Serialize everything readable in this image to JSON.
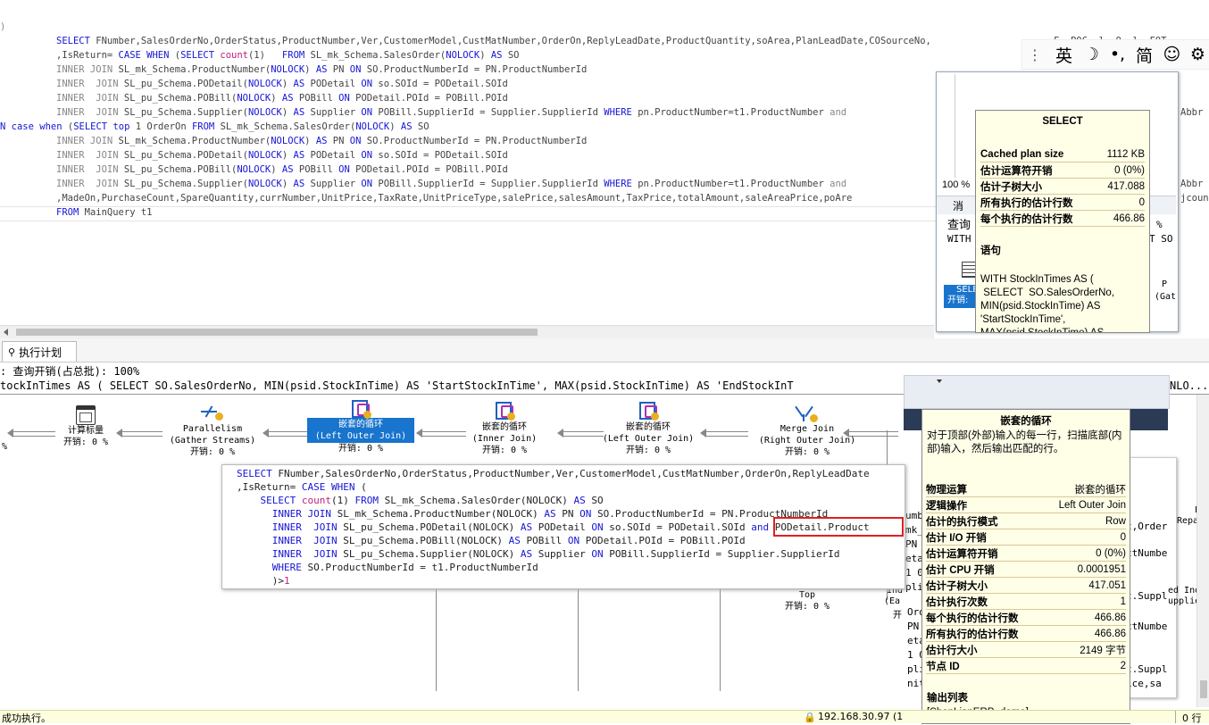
{
  "sql_editor": {
    "lines": [
      {
        "indent": 0,
        "parts": [
          {
            "t": ")",
            "c": "gray"
          }
        ]
      },
      {
        "indent": 63,
        "parts": [
          {
            "t": "SELECT",
            "c": "kw"
          },
          {
            "t": " FNumber,SalesOrderNo,OrderStatus,ProductNumber,Ver,CustomerModel,CustMatNumber,OrderOn,ReplyLeadDate,ProductQuantity,soArea,PlanLeadDate,COSourceNo,",
            "c": ""
          }
        ]
      },
      {
        "indent": 63,
        "parts": [
          {
            "t": ",IsReturn= ",
            "c": ""
          },
          {
            "t": "CASE WHEN",
            "c": "kw"
          },
          {
            "t": " (",
            "c": ""
          },
          {
            "t": "SELECT",
            "c": "kw"
          },
          {
            "t": " ",
            "c": ""
          },
          {
            "t": "count",
            "c": "fn"
          },
          {
            "t": "(1)   ",
            "c": ""
          },
          {
            "t": "FROM",
            "c": "kw"
          },
          {
            "t": " SL_mk_Schema.SalesOrder(",
            "c": ""
          },
          {
            "t": "NOLOCK",
            "c": "kw"
          },
          {
            "t": ") ",
            "c": ""
          },
          {
            "t": "AS",
            "c": "kw"
          },
          {
            "t": " SO",
            "c": ""
          }
        ]
      },
      {
        "indent": 63,
        "parts": [
          {
            "t": "INNER JOIN",
            "c": "gray"
          },
          {
            "t": " SL_mk_Schema.ProductNumber(",
            "c": ""
          },
          {
            "t": "NOLOCK",
            "c": "kw"
          },
          {
            "t": ") ",
            "c": ""
          },
          {
            "t": "AS",
            "c": "kw"
          },
          {
            "t": " PN ",
            "c": ""
          },
          {
            "t": "ON",
            "c": "kw"
          },
          {
            "t": " SO.ProductNumberId = PN.ProductNumberId",
            "c": ""
          }
        ]
      },
      {
        "indent": 63,
        "parts": [
          {
            "t": "INNER  JOIN",
            "c": "gray"
          },
          {
            "t": " SL_pu_Schema.PODetail(",
            "c": ""
          },
          {
            "t": "NOLOCK",
            "c": "kw"
          },
          {
            "t": ") ",
            "c": ""
          },
          {
            "t": "AS",
            "c": "kw"
          },
          {
            "t": " PODetail ",
            "c": ""
          },
          {
            "t": "ON",
            "c": "kw"
          },
          {
            "t": " so.SOId = PODetail.SOId",
            "c": ""
          }
        ]
      },
      {
        "indent": 63,
        "parts": [
          {
            "t": "INNER  JOIN",
            "c": "gray"
          },
          {
            "t": " SL_pu_Schema.POBill(",
            "c": ""
          },
          {
            "t": "NOLOCK",
            "c": "kw"
          },
          {
            "t": ") ",
            "c": ""
          },
          {
            "t": "AS",
            "c": "kw"
          },
          {
            "t": " POBill ",
            "c": ""
          },
          {
            "t": "ON",
            "c": "kw"
          },
          {
            "t": " PODetail.POId = POBill.POId",
            "c": ""
          }
        ]
      },
      {
        "indent": 63,
        "parts": [
          {
            "t": "INNER  JOIN",
            "c": "gray"
          },
          {
            "t": " SL_pu_Schema.Supplier(",
            "c": ""
          },
          {
            "t": "NOLOCK",
            "c": "kw"
          },
          {
            "t": ") ",
            "c": ""
          },
          {
            "t": "AS",
            "c": "kw"
          },
          {
            "t": " Supplier ",
            "c": ""
          },
          {
            "t": "ON",
            "c": "kw"
          },
          {
            "t": " POBill.SupplierId = Supplier.SupplierId ",
            "c": ""
          },
          {
            "t": "WHERE",
            "c": "kw"
          },
          {
            "t": " pn.ProductNumber=t1.ProductNumber ",
            "c": ""
          },
          {
            "t": "and",
            "c": "gray"
          }
        ]
      },
      {
        "indent": 0,
        "parts": [
          {
            "t": "N case when",
            "c": "kw"
          },
          {
            "t": " (",
            "c": ""
          },
          {
            "t": "SELECT top",
            "c": "kw"
          },
          {
            "t": " 1 OrderOn ",
            "c": ""
          },
          {
            "t": "FROM",
            "c": "kw"
          },
          {
            "t": " SL_mk_Schema.SalesOrder(",
            "c": ""
          },
          {
            "t": "NOLOCK",
            "c": "kw"
          },
          {
            "t": ") ",
            "c": ""
          },
          {
            "t": "AS",
            "c": "kw"
          },
          {
            "t": " SO",
            "c": ""
          }
        ]
      },
      {
        "indent": 63,
        "parts": [
          {
            "t": "INNER JOIN",
            "c": "gray"
          },
          {
            "t": " SL_mk_Schema.ProductNumber(",
            "c": ""
          },
          {
            "t": "NOLOCK",
            "c": "kw"
          },
          {
            "t": ") ",
            "c": ""
          },
          {
            "t": "AS",
            "c": "kw"
          },
          {
            "t": " PN ",
            "c": ""
          },
          {
            "t": "ON",
            "c": "kw"
          },
          {
            "t": " SO.ProductNumberId = PN.ProductNumberId",
            "c": ""
          }
        ]
      },
      {
        "indent": 63,
        "parts": [
          {
            "t": "INNER  JOIN",
            "c": "gray"
          },
          {
            "t": " SL_pu_Schema.PODetail(",
            "c": ""
          },
          {
            "t": "NOLOCK",
            "c": "kw"
          },
          {
            "t": ") ",
            "c": ""
          },
          {
            "t": "AS",
            "c": "kw"
          },
          {
            "t": " PODetail ",
            "c": ""
          },
          {
            "t": "ON",
            "c": "kw"
          },
          {
            "t": " so.SOId = PODetail.SOId",
            "c": ""
          }
        ]
      },
      {
        "indent": 63,
        "parts": [
          {
            "t": "INNER  JOIN",
            "c": "gray"
          },
          {
            "t": " SL_pu_Schema.POBill(",
            "c": ""
          },
          {
            "t": "NOLOCK",
            "c": "kw"
          },
          {
            "t": ") ",
            "c": ""
          },
          {
            "t": "AS",
            "c": "kw"
          },
          {
            "t": " POBill ",
            "c": ""
          },
          {
            "t": "ON",
            "c": "kw"
          },
          {
            "t": " PODetail.POId = POBill.POId",
            "c": ""
          }
        ]
      },
      {
        "indent": 63,
        "parts": [
          {
            "t": "INNER  JOIN",
            "c": "gray"
          },
          {
            "t": " SL_pu_Schema.Supplier(",
            "c": ""
          },
          {
            "t": "NOLOCK",
            "c": "kw"
          },
          {
            "t": ") ",
            "c": ""
          },
          {
            "t": "AS",
            "c": "kw"
          },
          {
            "t": " Supplier ",
            "c": ""
          },
          {
            "t": "ON",
            "c": "kw"
          },
          {
            "t": " POBill.SupplierId = Supplier.SupplierId ",
            "c": ""
          },
          {
            "t": "WHERE",
            "c": "kw"
          },
          {
            "t": " pn.ProductNumber=t1.ProductNumber ",
            "c": ""
          },
          {
            "t": "and",
            "c": "gray"
          }
        ]
      },
      {
        "indent": 63,
        "parts": [
          {
            "t": ",MadeOn,PurchaseCount,SpareQuantity,currNumber,UnitPrice,TaxRate,UnitPriceType,salePrice,salesAmount,TaxPrice,totalAmount,saleAreaPrice,poAre",
            "c": ""
          }
        ]
      },
      {
        "indent": 63,
        "parts": [
          {
            "t": "FROM",
            "c": "kw"
          },
          {
            "t": " MainQuery t1",
            "c": ""
          }
        ]
      }
    ],
    "right_fragments": {
      "r1": "Abbr",
      "r2": "Abbr",
      "r3": "jcoun",
      "top": "F  POC  l  O  l  FOT"
    }
  },
  "ime_toolbar": {
    "items": [
      "英",
      "☽",
      "•,",
      "简",
      "☺",
      "⚙"
    ]
  },
  "panel_tabs": {
    "exec_plan": "执行计划"
  },
  "plan_header": {
    "cost": ": 查询开销(占总批): 100%",
    "query": "tockInTimes AS ( SELECT SO.SalesOrderNo, MIN(psid.StockInTime) AS 'StartStockInTime', MAX(psid.StockInTime) AS 'EndStockInT",
    "query_tail": "NLO..."
  },
  "plan_nodes": [
    {
      "name": "计算标量",
      "sub": "",
      "cost": "开销: 0 %"
    },
    {
      "name": "Parallelism",
      "sub": "(Gather Streams)",
      "cost": "开销: 0 %"
    },
    {
      "name": "嵌套的循环",
      "sub": "(Left Outer Join)",
      "cost": "开销: 0 %"
    },
    {
      "name": "嵌套的循环",
      "sub": "(Inner Join)",
      "cost": "开销: 0 %"
    },
    {
      "name": "嵌套的循环",
      "sub": "(Left Outer Join)",
      "cost": "开销: 0 %"
    },
    {
      "name": "Merge Join",
      "sub": "(Right Outer Join)",
      "cost": "开销: 0 %"
    }
  ],
  "left_cost_frag": "%",
  "top_node": {
    "name": "Top",
    "cost": "开销: 0 %"
  },
  "sql_popup": {
    "lines": [
      [
        {
          "t": "SELECT",
          "c": "kw"
        },
        {
          "t": " FNumber,SalesOrderNo,OrderStatus,ProductNumber,Ver,CustomerModel,CustMatNumber,OrderOn,ReplyLeadDate",
          "c": ""
        }
      ],
      [
        {
          "t": ",IsReturn= ",
          "c": ""
        },
        {
          "t": "CASE WHEN",
          "c": "kw"
        },
        {
          "t": " (",
          "c": ""
        }
      ],
      [
        {
          "t": "    SELECT",
          "c": "kw"
        },
        {
          "t": " ",
          "c": ""
        },
        {
          "t": "count",
          "c": "fn"
        },
        {
          "t": "(1) ",
          "c": ""
        },
        {
          "t": "FROM",
          "c": "kw"
        },
        {
          "t": " SL_mk_Schema.SalesOrder(NOLOCK) ",
          "c": ""
        },
        {
          "t": "AS",
          "c": "kw"
        },
        {
          "t": " SO",
          "c": ""
        }
      ],
      [
        {
          "t": "      INNER JOIN",
          "c": "kw"
        },
        {
          "t": " SL_mk_Schema.ProductNumber(NOLOCK) ",
          "c": ""
        },
        {
          "t": "AS",
          "c": "kw"
        },
        {
          "t": " PN ",
          "c": ""
        },
        {
          "t": "ON",
          "c": "kw"
        },
        {
          "t": " SO.ProductNumberId = PN.ProductNumberId",
          "c": ""
        }
      ],
      [
        {
          "t": "      INNER  JOIN",
          "c": "kw"
        },
        {
          "t": " SL_pu_Schema.PODetail(NOLOCK) ",
          "c": ""
        },
        {
          "t": "AS",
          "c": "kw"
        },
        {
          "t": " PODetail ",
          "c": ""
        },
        {
          "t": "ON",
          "c": "kw"
        },
        {
          "t": " so.SOId = PODetail.SOId ",
          "c": ""
        },
        {
          "t": "and",
          "c": "kw"
        },
        {
          "t": " PODetail.Product",
          "c": ""
        }
      ],
      [
        {
          "t": "      INNER  JOIN",
          "c": "kw"
        },
        {
          "t": " SL_pu_Schema.POBill(NOLOCK) ",
          "c": ""
        },
        {
          "t": "AS",
          "c": "kw"
        },
        {
          "t": " POBill ",
          "c": ""
        },
        {
          "t": "ON",
          "c": "kw"
        },
        {
          "t": " PODetail.POId = POBill.POId",
          "c": ""
        }
      ],
      [
        {
          "t": "      INNER  JOIN",
          "c": "kw"
        },
        {
          "t": " SL_pu_Schema.Supplier(NOLOCK) ",
          "c": ""
        },
        {
          "t": "AS",
          "c": "kw"
        },
        {
          "t": " Supplier ",
          "c": ""
        },
        {
          "t": "ON",
          "c": "kw"
        },
        {
          "t": " POBill.SupplierId = Supplier.SupplierId",
          "c": ""
        }
      ],
      [
        {
          "t": "      WHERE",
          "c": "kw"
        },
        {
          "t": " SO.ProductNumberId = t1.ProductNumberId",
          "c": ""
        }
      ],
      [
        {
          "t": "      )>",
          "c": ""
        },
        {
          "t": "1",
          "c": "fn"
        }
      ]
    ]
  },
  "tooltip_select": {
    "title": "SELECT",
    "rows": [
      {
        "k": "Cached plan size",
        "v": "1112 KB"
      },
      {
        "k": "估计运算符开销",
        "v": "0 (0%)"
      },
      {
        "k": "估计子树大小",
        "v": "417.088"
      },
      {
        "k": "所有执行的估计行数",
        "v": "0"
      },
      {
        "k": "每个执行的估计行数",
        "v": "466.86"
      }
    ],
    "stmt_label": "语句",
    "stmt": "WITH StockInTimes AS (\n SELECT  SO.SalesOrderNo,\nMIN(psid.StockInTime) AS\n'StartStockInTime',\nMAX(psid.StockInTime) AS"
  },
  "side_panel": {
    "zoom": "100 %",
    "tab": "消",
    "query": "查询",
    "with": "WITH",
    "sel": "SELE",
    "cost": "开销:",
    "frag1": "%",
    "frag2": "T SO",
    "frag3": "P",
    "frag4": "(Gat"
  },
  "tooltip_nl": {
    "title": "嵌套的循环",
    "desc": "对于顶部(外部)输入的每一行，扫描底部(内部)输入，然后输出匹配的行。",
    "rows": [
      {
        "k": "物理运算",
        "v": "嵌套的循环"
      },
      {
        "k": "逻辑操作",
        "v": "Left Outer Join"
      },
      {
        "k": "估计的执行模式",
        "v": "Row"
      },
      {
        "k": "估计 I/O 开销",
        "v": "0"
      },
      {
        "k": "估计运算符开销",
        "v": "0 (0%)"
      },
      {
        "k": "估计 CPU 开销",
        "v": "0.0001951"
      },
      {
        "k": "估计子树大小",
        "v": "417.051"
      },
      {
        "k": "估计执行次数",
        "v": "1"
      },
      {
        "k": "每个执行的估计行数",
        "v": "466.86"
      },
      {
        "k": "所有执行的估计行数",
        "v": "466.86"
      },
      {
        "k": "估计行大小",
        "v": "2149 字节"
      },
      {
        "k": "节点 ID",
        "v": "2"
      }
    ],
    "out_label": "输出列表",
    "out": "[ShenLianERP_demo].\n[SL_mk_Schema].\n[SalesOrder].RootSOId,"
  },
  "bg_fragments": {
    "a": "umb",
    "b": "eta",
    "c": "1 0",
    "d": "pli",
    "e": "Ord",
    "f": "PN",
    "g": "eta",
    "h": "1 0",
    "i": "pli",
    "j": "nit",
    "k": "mk_",
    "r1": "t,Order",
    "r2": "ctNumbe",
    "r3": "t.Suppl",
    "r4": "ctNumbe",
    "r5": "t.Suppl",
    "r6": "ice,sa",
    "pa": "Pa",
    "rep": "Repart",
    "edind": "ed Ind",
    "suppl": "upplie",
    "kai": "开",
    "ind": "Ind",
    "ea": "(Ea",
    "kai2": "开"
  },
  "status": {
    "left": "成功执行。",
    "server": "192.168.30.97 (1",
    "right": "0 行"
  }
}
